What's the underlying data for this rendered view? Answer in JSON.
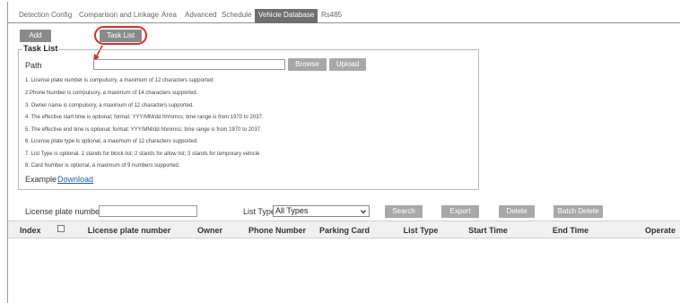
{
  "tabs": [
    {
      "label": "Detection Config",
      "active": false
    },
    {
      "label": "Comparison and Linkage",
      "active": false
    },
    {
      "label": "Area",
      "active": false
    },
    {
      "label": "Advanced",
      "active": false
    },
    {
      "label": "Schedule",
      "active": false
    },
    {
      "label": "Vehicle Database",
      "active": true
    },
    {
      "label": "Rs485",
      "active": false
    }
  ],
  "toolbar": {
    "add_label": "Add",
    "task_list_label": "Task List"
  },
  "task_list": {
    "legend": "Task List",
    "path_label": "Path",
    "path_value": "",
    "browse_label": "Browse",
    "upload_label": "Upload",
    "notes": [
      "1. License plate number is compulsory, a maximum of 12 characters supported.",
      "2.Phone Number is compulsory, a maximum of 14 characters supported.",
      "3. Owner name is compulsory, a maximum of 12 characters supported.",
      "4. The effective start time is optional; format: YYY/MM/dd hhmmss; time range is from 1970 to 2037.",
      "5. The effective end time is optional; format: YYY/MM/dd hhmmss; time range is from 1970 to 2037.",
      "6. License plate type is optional, a maximum of 12 characters supported.",
      "7. List Type is optional. 1 stands for block list; 2 stands for allow list; 3 stands for temporary vehicle",
      "8. Card Number is optional, a maximum of 9 numbers supported."
    ],
    "example_label": "Example",
    "download_label": "Download"
  },
  "filters": {
    "license_plate_label": "License plate number",
    "license_plate_value": "",
    "list_type_label": "List Type",
    "list_type_selected": "All Types",
    "search_label": "Search",
    "export_label": "Export",
    "delete_label": "Delete",
    "batch_delete_label": "Batch Delete"
  },
  "table": {
    "headers": {
      "index": "Index",
      "license_plate": "License plate number",
      "owner": "Owner",
      "phone": "Phone Number",
      "parking_card": "Parking Card",
      "list_type": "List Type",
      "start_time": "Start Time",
      "end_time": "End Time",
      "operate": "Operate"
    },
    "rows": []
  },
  "colors": {
    "annotation": "#e02a22",
    "link": "#1c5fb8",
    "button": "#8a8a8a",
    "active_tab": "#6f6f6f"
  },
  "icons": {
    "select_chevron": "chevron-down-icon",
    "annotation_arrow": "red-arrow-icon"
  }
}
